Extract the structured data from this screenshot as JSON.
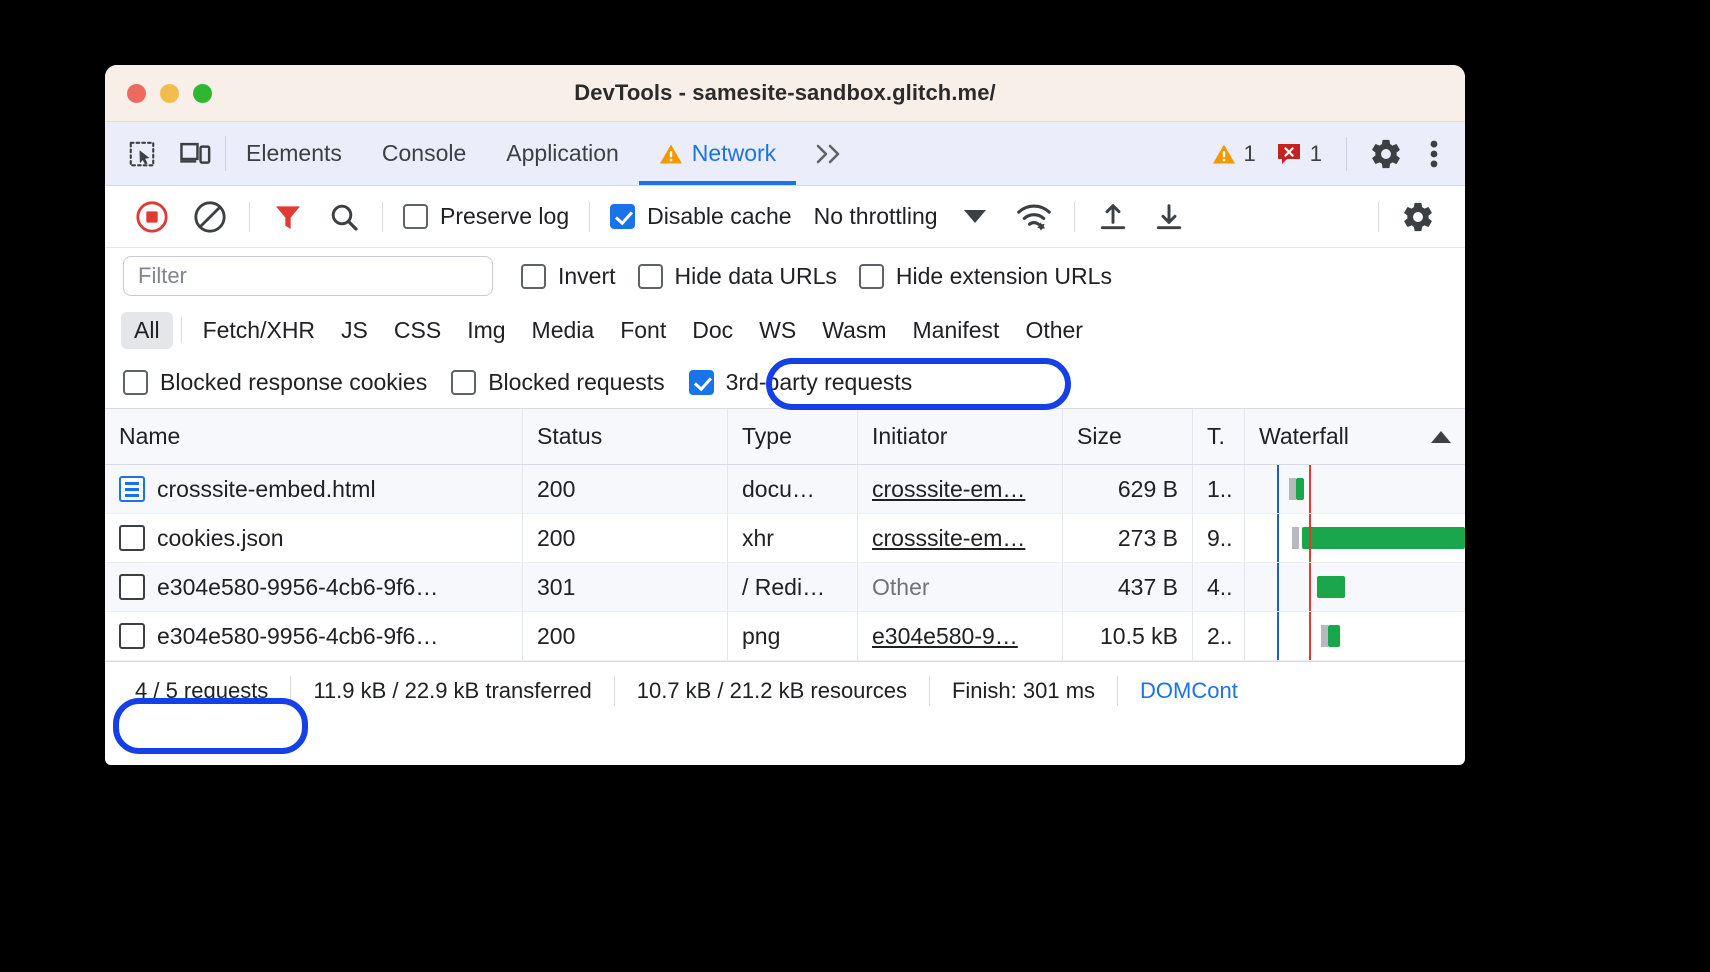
{
  "window": {
    "title": "DevTools - samesite-sandbox.glitch.me/",
    "traffic_lights": [
      "close-red",
      "minimize-yellow",
      "maximize-green"
    ]
  },
  "tabstrip": {
    "left_icons": [
      "inspect-element-icon",
      "device-toolbar-icon"
    ],
    "tabs": [
      {
        "label": "Elements",
        "active": false,
        "warning": false
      },
      {
        "label": "Console",
        "active": false,
        "warning": false
      },
      {
        "label": "Application",
        "active": false,
        "warning": false
      },
      {
        "label": "Network",
        "active": true,
        "warning": true
      }
    ],
    "overflow_label": "»",
    "warning_count": "1",
    "error_count": "1",
    "settings_icon": "gear-icon",
    "more_icon": "kebab-menu-icon"
  },
  "toolbar": {
    "record_icon": "record-stop-icon",
    "clear_icon": "clear-icon",
    "filter_icon": "filter-funnel-icon",
    "search_icon": "search-icon",
    "preserve_log": {
      "label": "Preserve log",
      "checked": false
    },
    "disable_cache": {
      "label": "Disable cache",
      "checked": true
    },
    "throttling": {
      "value": "No throttling"
    },
    "network_conditions_icon": "wifi-settings-icon",
    "import_icon": "import-har-icon",
    "export_icon": "export-har-icon",
    "settings_icon": "gear-icon"
  },
  "filter_row": {
    "filter_input": {
      "placeholder": "Filter",
      "value": ""
    },
    "invert": {
      "label": "Invert",
      "checked": false
    },
    "hide_data_urls": {
      "label": "Hide data URLs",
      "checked": false
    },
    "hide_extension_urls": {
      "label": "Hide extension URLs",
      "checked": false
    }
  },
  "type_filters": [
    {
      "label": "All",
      "active": true
    },
    {
      "label": "Fetch/XHR",
      "active": false
    },
    {
      "label": "JS",
      "active": false
    },
    {
      "label": "CSS",
      "active": false
    },
    {
      "label": "Img",
      "active": false
    },
    {
      "label": "Media",
      "active": false
    },
    {
      "label": "Font",
      "active": false
    },
    {
      "label": "Doc",
      "active": false
    },
    {
      "label": "WS",
      "active": false
    },
    {
      "label": "Wasm",
      "active": false
    },
    {
      "label": "Manifest",
      "active": false
    },
    {
      "label": "Other",
      "active": false
    }
  ],
  "more_filters": {
    "blocked_response_cookies": {
      "label": "Blocked response cookies",
      "checked": false
    },
    "blocked_requests": {
      "label": "Blocked requests",
      "checked": false
    },
    "third_party_requests": {
      "label": "3rd-party requests",
      "checked": true,
      "highlighted": true
    }
  },
  "table": {
    "columns": [
      "Name",
      "Status",
      "Type",
      "Initiator",
      "Size",
      "T.",
      "Waterfall"
    ],
    "sort_column": "Waterfall",
    "sort_direction": "ascending",
    "rows": [
      {
        "icon": "document-icon",
        "name": "crosssite-embed.html",
        "status": "200",
        "type": "docu…",
        "initiator": "crosssite-em…",
        "initiator_link": true,
        "size": "629 B",
        "time": "1..",
        "selected": true
      },
      {
        "icon": "generic-file-icon",
        "name": "cookies.json",
        "status": "200",
        "type": "xhr",
        "initiator": "crosssite-em…",
        "initiator_link": true,
        "size": "273 B",
        "time": "9..",
        "selected": false
      },
      {
        "icon": "generic-file-icon",
        "name": "e304e580-9956-4cb6-9f6…",
        "status": "301",
        "type": "/ Redi…",
        "initiator": "Other",
        "initiator_link": false,
        "size": "437 B",
        "time": "4..",
        "selected": false
      },
      {
        "icon": "generic-file-icon",
        "name": "e304e580-9956-4cb6-9f6…",
        "status": "200",
        "type": "png",
        "initiator": "e304e580-9…",
        "initiator_link": true,
        "size": "10.5 kB",
        "time": "2..",
        "selected": false
      }
    ]
  },
  "footer": {
    "requests": "4 / 5 requests",
    "transferred": "11.9 kB / 22.9 kB transferred",
    "resources": "10.7 kB / 21.2 kB resources",
    "finish": "Finish: 301 ms",
    "domcontentloaded": "DOMCont"
  },
  "colors": {
    "accent_blue": "#1a73e8",
    "annotation_blue": "#1540e8",
    "warning_orange": "#f29900",
    "error_red": "#c5221f",
    "waterfall_green": "#1aa64b",
    "record_red": "#e03a34"
  }
}
